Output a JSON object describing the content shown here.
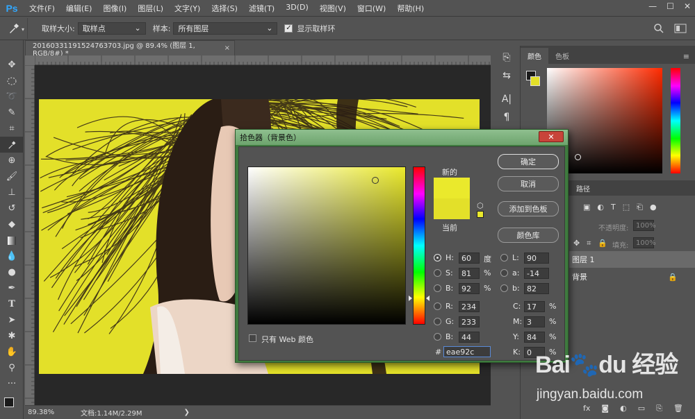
{
  "app": {
    "logo": "Ps"
  },
  "menu": [
    "文件(F)",
    "编辑(E)",
    "图像(I)",
    "图层(L)",
    "文字(Y)",
    "选择(S)",
    "滤镜(T)",
    "3D(D)",
    "视图(V)",
    "窗口(W)",
    "帮助(H)"
  ],
  "window_controls": {
    "minimize": "—",
    "maximize": "☐",
    "close": "✕"
  },
  "options": {
    "sample_size_label": "取样大小:",
    "sample_size_value": "取样点",
    "sample_label": "样本:",
    "sample_value": "所有图层",
    "show_ring_label": "显示取样环",
    "show_ring_checked": true
  },
  "document": {
    "tab_title": "20160331191524763703.jpg @ 89.4% (图层 1, RGB/8#) *",
    "close": "×",
    "zoom": "89.38%",
    "doc_size": "文档:1.14M/2.29M",
    "arrow": "❯"
  },
  "right_panel": {
    "tabs": [
      "颜色",
      "色板"
    ],
    "layers_tab": "路径",
    "opacity_label": "不透明度:",
    "opacity_value": "100%",
    "fill_label": "填充:",
    "fill_value": "100%",
    "layer1": "图层 1",
    "background_layer": "背景"
  },
  "dialog": {
    "title": "拾色器（背景色）",
    "close_label": "✕",
    "new_label": "新的",
    "current_label": "当前",
    "ok": "确定",
    "cancel": "取消",
    "add_to_swatches": "添加到色板",
    "color_libraries": "颜色库",
    "web_only_label": "只有 Web 颜色",
    "hsb": {
      "H": "60",
      "S": "81",
      "B": "92",
      "H_unit": "度",
      "S_unit": "%",
      "B_unit": "%"
    },
    "rgb": {
      "R": "234",
      "G": "233",
      "B": "44"
    },
    "lab": {
      "L": "90",
      "a": "-14",
      "b": "82"
    },
    "cmyk": {
      "C": "17",
      "M": "3",
      "Y": "84",
      "K": "0",
      "unit": "%"
    },
    "hex_prefix": "#",
    "hex": "eae92c",
    "new_color": "#eae92c",
    "current_color": "#e3e029",
    "selected_mode": "H"
  },
  "watermark": {
    "site": "jingyan.baidu.com"
  }
}
